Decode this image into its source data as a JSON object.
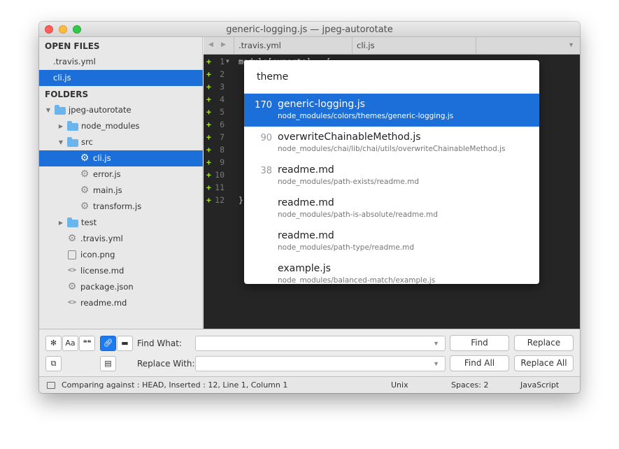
{
  "window": {
    "title": "generic-logging.js — jpeg-autorotate"
  },
  "sidebar": {
    "open_files_heading": "OPEN FILES",
    "open_files": [
      ".travis.yml",
      "cli.js"
    ],
    "folders_heading": "FOLDERS",
    "tree": [
      {
        "label": "jpeg-autorotate",
        "icon": "folder-icon",
        "expanded": true
      },
      {
        "label": "node_modules",
        "icon": "folder-icon",
        "expanded": false
      },
      {
        "label": "src",
        "icon": "folder-icon",
        "expanded": true
      },
      {
        "label": "cli.js",
        "icon": "gear-icon",
        "selected": true
      },
      {
        "label": "error.js",
        "icon": "gear-icon"
      },
      {
        "label": "main.js",
        "icon": "gear-icon"
      },
      {
        "label": "transform.js",
        "icon": "gear-icon"
      },
      {
        "label": "test",
        "icon": "folder-icon",
        "expanded": false
      },
      {
        "label": ".travis.yml",
        "icon": "gear-icon"
      },
      {
        "label": "icon.png",
        "icon": "image-icon"
      },
      {
        "label": "license.md",
        "icon": "code-icon"
      },
      {
        "label": "package.json",
        "icon": "gear-icon"
      },
      {
        "label": "readme.md",
        "icon": "code-icon"
      }
    ]
  },
  "tabs": [
    ".travis.yml",
    "cli.js"
  ],
  "editor": {
    "line_numbers": [
      "1",
      "2",
      "3",
      "4",
      "5",
      "6",
      "7",
      "8",
      "9",
      "10",
      "11",
      "12"
    ],
    "line1_text": "module[exports] = {",
    "line12_text": "}"
  },
  "goto_popup": {
    "query": "theme",
    "results": [
      {
        "score": "170",
        "name": "generic-logging.js",
        "path": "node_modules/colors/themes/generic-logging.js"
      },
      {
        "score": "90",
        "name": "overwriteChainableMethod.js",
        "path": "node_modules/chai/lib/chai/utils/overwriteChainableMethod.js"
      },
      {
        "score": "38",
        "name": "readme.md",
        "path": "node_modules/path-exists/readme.md"
      },
      {
        "score": "",
        "name": "readme.md",
        "path": "node_modules/path-is-absolute/readme.md"
      },
      {
        "score": "",
        "name": "readme.md",
        "path": "node_modules/path-type/readme.md"
      },
      {
        "score": "",
        "name": "example.js",
        "path": "node_modules/balanced-match/example.js"
      }
    ]
  },
  "find_panel": {
    "regex_btn": "✻",
    "case_btn": "Aa",
    "word_btn": "❝❝",
    "find_what_label": "Find What:",
    "replace_with_label": "Replace With:",
    "find_btn": "Find",
    "replace_btn": "Replace",
    "find_all_btn": "Find All",
    "replace_all_btn": "Replace All"
  },
  "status_bar": {
    "message": "Comparing against : HEAD, Inserted : 12, Line 1, Column 1",
    "line_endings": "Unix",
    "indentation": "Spaces: 2",
    "syntax": "JavaScript"
  },
  "colors": {
    "accent": "#1c6fd9",
    "editor_bg": "#252525",
    "diff_plus": "#a6e22e"
  }
}
